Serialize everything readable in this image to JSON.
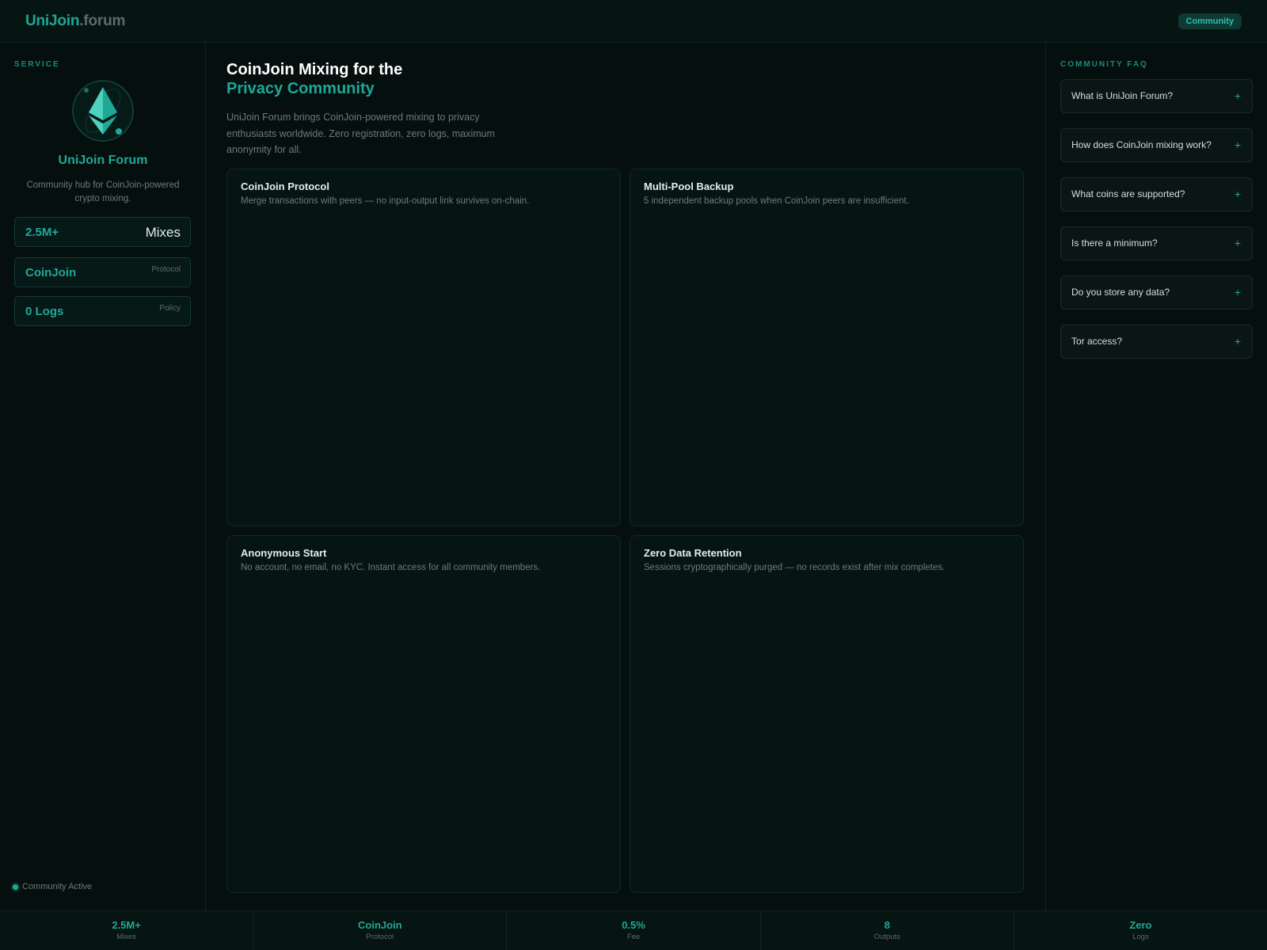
{
  "header": {
    "brand_primary": "UniJoin",
    "brand_secondary": ".forum",
    "badge": "Community"
  },
  "sidebar": {
    "section_label": "SERVICE",
    "logo_icon": "ethereum-icon",
    "name": "UniJoin Forum",
    "description": "Community hub for CoinJoin-powered crypto mixing.",
    "stats": [
      {
        "value": "2.5M+",
        "label": "Mixes"
      },
      {
        "value": "CoinJoin",
        "label": "Protocol"
      },
      {
        "value": "0 Logs",
        "label": "Policy"
      }
    ],
    "status": "Community Active"
  },
  "main": {
    "title_line1": "CoinJoin Mixing for the",
    "title_line2": "Privacy Community",
    "lead": "UniJoin Forum brings CoinJoin-powered mixing to privacy enthusiasts worldwide. Zero registration, zero logs, maximum anonymity for all.",
    "cards": [
      {
        "title": "CoinJoin Protocol",
        "desc": "Merge transactions with peers — no input-output link survives on-chain."
      },
      {
        "title": "Multi-Pool Backup",
        "desc": "5 independent backup pools when CoinJoin peers are insufficient."
      },
      {
        "title": "Anonymous Start",
        "desc": "No account, no email, no KYC. Instant access for all community members."
      },
      {
        "title": "Zero Data Retention",
        "desc": "Sessions cryptographically purged — no records exist after mix completes."
      }
    ]
  },
  "faq": {
    "label": "COMMUNITY FAQ",
    "items": [
      {
        "q": "What is UniJoin Forum?",
        "icon": "+"
      },
      {
        "q": "How does CoinJoin mixing work?",
        "icon": "+"
      },
      {
        "q": "What coins are supported?",
        "icon": "+"
      },
      {
        "q": "Is there a minimum?",
        "icon": "+"
      },
      {
        "q": "Do you store any data?",
        "icon": "+"
      },
      {
        "q": "Tor access?",
        "icon": "+"
      }
    ]
  },
  "footer": {
    "stats": [
      {
        "value": "2.5M+",
        "label": "Mixes"
      },
      {
        "value": "CoinJoin",
        "label": "Protocol"
      },
      {
        "value": "0.5%",
        "label": "Fee"
      },
      {
        "value": "8",
        "label": "Outputs"
      },
      {
        "value": "Zero",
        "label": "Logs"
      }
    ]
  },
  "colors": {
    "accent": "#1fa896",
    "background": "#040f0e",
    "text_muted": "#6d7b79"
  }
}
